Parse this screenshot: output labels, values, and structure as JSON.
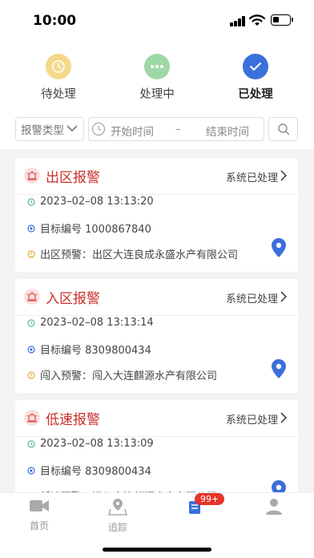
{
  "status_bar": {
    "time": "10:00"
  },
  "status_tabs": [
    {
      "label": "待处理",
      "color": "#f5d98a",
      "icon": "clock-icon"
    },
    {
      "label": "处理中",
      "color": "#9ed8a4",
      "icon": "more-dots-icon"
    },
    {
      "label": "已处理",
      "color": "#3a6fdc",
      "icon": "check-icon"
    }
  ],
  "filters": {
    "type_label": "报警类型",
    "start_placeholder": "开始时间",
    "separator": "–",
    "end_placeholder": "结束时间"
  },
  "alarms": [
    {
      "title": "出区报警",
      "status": "系统已处理",
      "time": "2023–02–08 13:13:20",
      "target": "目标编号 1000867840",
      "detail": "出区预警：出区大连良成永盛水产有限公司"
    },
    {
      "title": "入区报警",
      "status": "系统已处理",
      "time": "2023–02–08 13:13:14",
      "target": "目标编号 8309800434",
      "detail": "闯入预警：闯入大连麒源水产有限公司"
    },
    {
      "title": "低速报警",
      "status": "系统已处理",
      "time": "2023–02–08 13:13:09",
      "target": "目标编号 8309800434",
      "detail": "低速预警：进入大连麒源水产有限公司"
    }
  ],
  "tabbar": {
    "items": [
      {
        "label": "首页",
        "icon": "video-camera-icon"
      },
      {
        "label": "追踪",
        "icon": "map-pin-icon"
      },
      {
        "label": "",
        "icon": "alarm-list-icon"
      },
      {
        "label": "",
        "icon": "person-icon"
      }
    ],
    "badge": "99+"
  },
  "colors": {
    "accent": "#3a6fdc",
    "alarm_red": "#c9302c",
    "badge": "#e8332a"
  }
}
